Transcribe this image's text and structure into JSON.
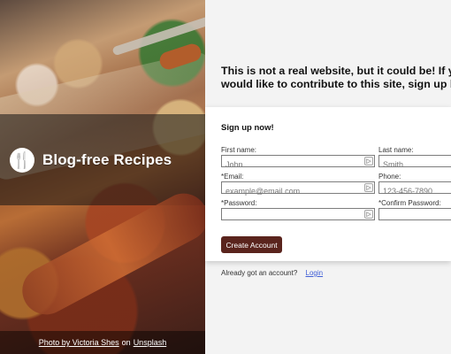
{
  "brand": {
    "icon": "fork-knife-icon",
    "name": "Blog-free Recipes"
  },
  "photo_credit": {
    "photo_text": "Photo by Victoria Shes",
    "on_text": "on",
    "source_text": "Unsplash"
  },
  "signup": {
    "pitch_line_1": "This is not a real website, but it could be! If you t",
    "pitch_line_2": "would like to contribute to this site, sign up belo",
    "heading": "Sign up now!",
    "fields": {
      "first_name": {
        "label": "First name:",
        "placeholder": "John"
      },
      "last_name": {
        "label": "Last name:",
        "placeholder": "Smith"
      },
      "email": {
        "label": "*Email:",
        "placeholder": "example@email.com"
      },
      "phone": {
        "label": "Phone:",
        "placeholder": "123-456-7890"
      },
      "password": {
        "label": "*Password:",
        "placeholder": ""
      },
      "confirm_password": {
        "label": "*Confirm Password:",
        "placeholder": ""
      }
    },
    "button_label": "Create Account",
    "already_text": "Already got an account?",
    "login_text": "Login"
  },
  "colors": {
    "button": "#5a241d",
    "link": "#3f5ed6"
  }
}
